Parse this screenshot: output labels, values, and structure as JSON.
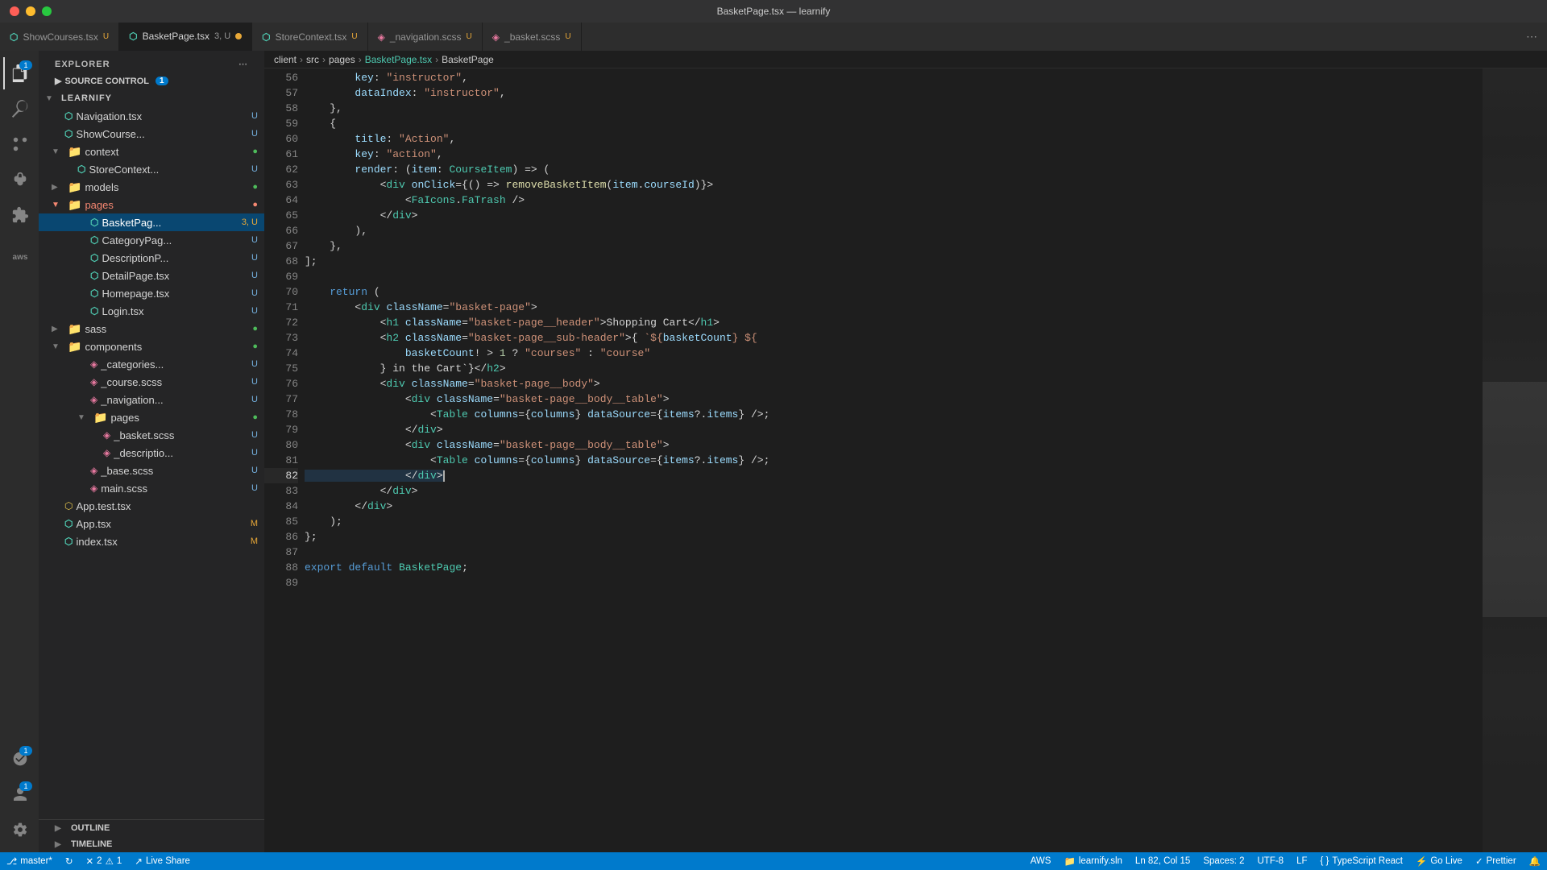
{
  "titleBar": {
    "title": "BasketPage.tsx — learnify"
  },
  "tabs": [
    {
      "id": "showcourses",
      "icon": "tsx",
      "label": "ShowCourses.tsx",
      "badge": "U",
      "active": false
    },
    {
      "id": "basketpage",
      "icon": "tsx",
      "label": "BasketPage.tsx",
      "badge": "3, U",
      "modified": true,
      "active": true
    },
    {
      "id": "storecontext",
      "icon": "tsx",
      "label": "StoreContext.tsx",
      "badge": "U",
      "active": false
    },
    {
      "id": "navigation",
      "icon": "scss",
      "label": "_navigation.scss",
      "badge": "U",
      "active": false
    },
    {
      "id": "basket",
      "icon": "scss",
      "label": "_basket.scss",
      "badge": "U",
      "active": false
    }
  ],
  "breadcrumb": {
    "items": [
      "client",
      "src",
      "pages",
      "BasketPage.tsx",
      "BasketPage"
    ]
  },
  "sidebar": {
    "header": "EXPLORER",
    "sourceControl": "SOURCE CONTROL",
    "projectName": "LEARNIFY",
    "badge": "1",
    "files": [
      {
        "name": "Navigation.tsx",
        "badge": "U",
        "type": "tsx",
        "indent": 2
      },
      {
        "name": "ShowCourse...",
        "badge": "U",
        "type": "tsx",
        "indent": 2
      },
      {
        "name": "context",
        "type": "folder",
        "indent": 1,
        "open": true
      },
      {
        "name": "StoreContext...",
        "badge": "U",
        "type": "tsx",
        "indent": 3
      },
      {
        "name": "models",
        "type": "folder",
        "indent": 1,
        "open": false
      },
      {
        "name": "pages",
        "type": "folder",
        "indent": 1,
        "open": true,
        "highlighted": true
      },
      {
        "name": "BasketPag...",
        "badge": "3, U",
        "type": "tsx",
        "indent": 4,
        "active": true
      },
      {
        "name": "CategoryPag...",
        "badge": "U",
        "type": "tsx",
        "indent": 4
      },
      {
        "name": "DescriptionP...",
        "badge": "U",
        "type": "tsx",
        "indent": 4
      },
      {
        "name": "DetailPage.tsx",
        "badge": "U",
        "type": "tsx",
        "indent": 4
      },
      {
        "name": "Homepage.tsx",
        "badge": "U",
        "type": "tsx",
        "indent": 4
      },
      {
        "name": "Login.tsx",
        "badge": "U",
        "type": "tsx",
        "indent": 4
      },
      {
        "name": "sass",
        "type": "folder",
        "indent": 1,
        "open": false
      },
      {
        "name": "components",
        "type": "folder",
        "indent": 1,
        "open": true
      },
      {
        "name": "_categories...",
        "badge": "U",
        "type": "scss",
        "indent": 4
      },
      {
        "name": "_course.scss",
        "badge": "U",
        "type": "scss",
        "indent": 4
      },
      {
        "name": "_navigation...",
        "badge": "U",
        "type": "scss",
        "indent": 4
      },
      {
        "name": "pages",
        "type": "folder",
        "indent": 3,
        "open": true
      },
      {
        "name": "_basket.scss",
        "badge": "U",
        "type": "scss",
        "indent": 5
      },
      {
        "name": "_descriptio...",
        "badge": "U",
        "type": "scss",
        "indent": 5
      },
      {
        "name": "_base.scss",
        "badge": "U",
        "type": "scss",
        "indent": 4
      },
      {
        "name": "main.scss",
        "badge": "U",
        "type": "scss",
        "indent": 4
      },
      {
        "name": "App.test.tsx",
        "type": "test",
        "indent": 1
      },
      {
        "name": "App.tsx",
        "badge": "M",
        "type": "tsx",
        "indent": 1
      },
      {
        "name": "index.tsx",
        "badge": "M",
        "type": "tsx",
        "indent": 1
      }
    ],
    "outline": "OUTLINE",
    "timeline": "TIMELINE"
  },
  "code": {
    "lines": [
      {
        "num": 56,
        "content": "        key: \"instructor\","
      },
      {
        "num": 57,
        "content": "        dataIndex: \"instructor\","
      },
      {
        "num": 58,
        "content": "    },"
      },
      {
        "num": 59,
        "content": "    {"
      },
      {
        "num": 60,
        "content": "        title: \"Action\","
      },
      {
        "num": 61,
        "content": "        key: \"action\","
      },
      {
        "num": 62,
        "content": "        render: (item: CourseItem) => ("
      },
      {
        "num": 63,
        "content": "            <div onClick={() => removeBasketItem(item.courseId)}>"
      },
      {
        "num": 64,
        "content": "                <FaIcons.FaTrash />"
      },
      {
        "num": 65,
        "content": "            </div>"
      },
      {
        "num": 66,
        "content": "        ),"
      },
      {
        "num": 67,
        "content": "    },"
      },
      {
        "num": 68,
        "content": "];"
      },
      {
        "num": 69,
        "content": ""
      },
      {
        "num": 70,
        "content": "    return ("
      },
      {
        "num": 71,
        "content": "        <div className=\"basket-page\">"
      },
      {
        "num": 72,
        "content": "            <h1 className=\"basket-page__header\">Shopping Cart</h1>"
      },
      {
        "num": 73,
        "content": "            <h2 className=\"basket-page__sub-header\">{ `${basketCount} ${"
      },
      {
        "num": 74,
        "content": "                basketCount! > 1 ? \"courses\" : \"course\""
      },
      {
        "num": 75,
        "content": "            } in the Cart`}</h2>"
      },
      {
        "num": 76,
        "content": "            <div className=\"basket-page__body\">"
      },
      {
        "num": 77,
        "content": "                <div className=\"basket-page__body__table\">"
      },
      {
        "num": 78,
        "content": "                    <Table columns={columns} dataSource={items?.items} />;"
      },
      {
        "num": 79,
        "content": "                </div>"
      },
      {
        "num": 80,
        "content": "                <div className=\"basket-page__body__table\">"
      },
      {
        "num": 81,
        "content": "                    <Table columns={columns} dataSource={items?.items} />;"
      },
      {
        "num": 82,
        "content": "                </div>",
        "active": true
      },
      {
        "num": 83,
        "content": "            </div>"
      },
      {
        "num": 84,
        "content": "        </div>"
      },
      {
        "num": 85,
        "content": "    );"
      },
      {
        "num": 86,
        "content": "};"
      },
      {
        "num": 87,
        "content": ""
      },
      {
        "num": 88,
        "content": "export default BasketPage;"
      },
      {
        "num": 89,
        "content": ""
      }
    ]
  },
  "statusBar": {
    "branch": "master*",
    "sync": "",
    "errors": "2",
    "warnings": "1",
    "liveshare": "Live Share",
    "aws": "AWS",
    "solution": "learnify.sln",
    "position": "Ln 82, Col 15",
    "spaces": "Spaces: 2",
    "encoding": "UTF-8",
    "lineEnding": "LF",
    "language": "TypeScript React",
    "golive": "Go Live",
    "prettier": "Prettier"
  }
}
